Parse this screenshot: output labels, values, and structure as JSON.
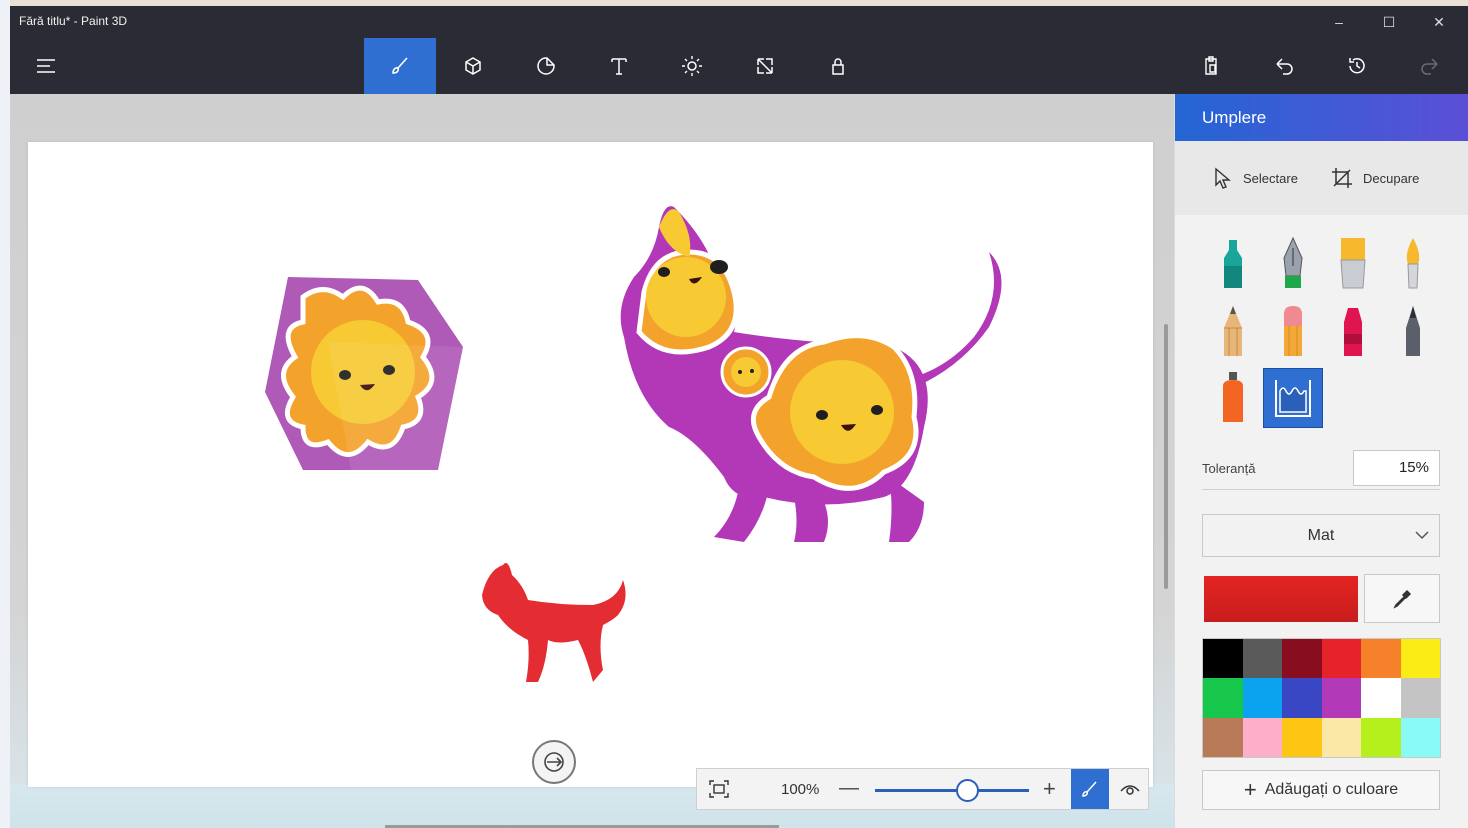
{
  "window": {
    "title": "Fără titlu* - Paint 3D",
    "controls": {
      "minimize": "–",
      "maximize": "☐",
      "close": "✕"
    }
  },
  "toolbar": {
    "menu_icon": "hamburger-menu-icon",
    "tools": [
      {
        "name": "brushes",
        "icon": "brush-icon",
        "active": true
      },
      {
        "name": "3d-shapes",
        "icon": "cube-icon"
      },
      {
        "name": "stickers",
        "icon": "sticker-icon"
      },
      {
        "name": "text",
        "icon": "text-icon"
      },
      {
        "name": "effects",
        "icon": "sun-icon"
      },
      {
        "name": "canvas",
        "icon": "resize-icon"
      },
      {
        "name": "3d-library",
        "icon": "library-icon"
      }
    ],
    "right_actions": [
      "paste-icon",
      "undo-icon",
      "history-icon",
      "redo-icon"
    ]
  },
  "zoom": {
    "value": "100%",
    "minus": "—",
    "plus": "+",
    "level": 0.5
  },
  "panel": {
    "title": "Umplere",
    "select_label": "Selectare",
    "crop_label": "Decupare",
    "brushes": [
      {
        "name": "marker",
        "color": "#1aa59a"
      },
      {
        "name": "calligraphy-pen",
        "color": "#1fa74b"
      },
      {
        "name": "oil-brush",
        "color": "#f6b92e"
      },
      {
        "name": "watercolor",
        "color": "#f6b92e"
      },
      {
        "name": "pencil",
        "color": "#e8b777"
      },
      {
        "name": "eraser",
        "color": "#f2a93a"
      },
      {
        "name": "crayon",
        "color": "#e0144f"
      },
      {
        "name": "pixel-pen",
        "color": "#5a5f6a"
      },
      {
        "name": "spray-can",
        "color": "#f26522"
      },
      {
        "name": "fill",
        "color": "#2f6fd1",
        "selected": true
      }
    ],
    "tolerance_label": "Toleranță",
    "tolerance_value": "15%",
    "finish": "Mat",
    "current_color": "#e42422",
    "palette": [
      "#000000",
      "#5a5a5a",
      "#880e1f",
      "#e6232a",
      "#f7812b",
      "#fcec16",
      "#17c74c",
      "#0ba3ef",
      "#3a47c5",
      "#b23ab9",
      "#ffffff",
      "#c4c4c4",
      "#b97a57",
      "#fdaec9",
      "#fdc612",
      "#fce8a6",
      "#b5f01c",
      "#8afaf6"
    ],
    "add_color_label": "Adăugați o culoare"
  }
}
